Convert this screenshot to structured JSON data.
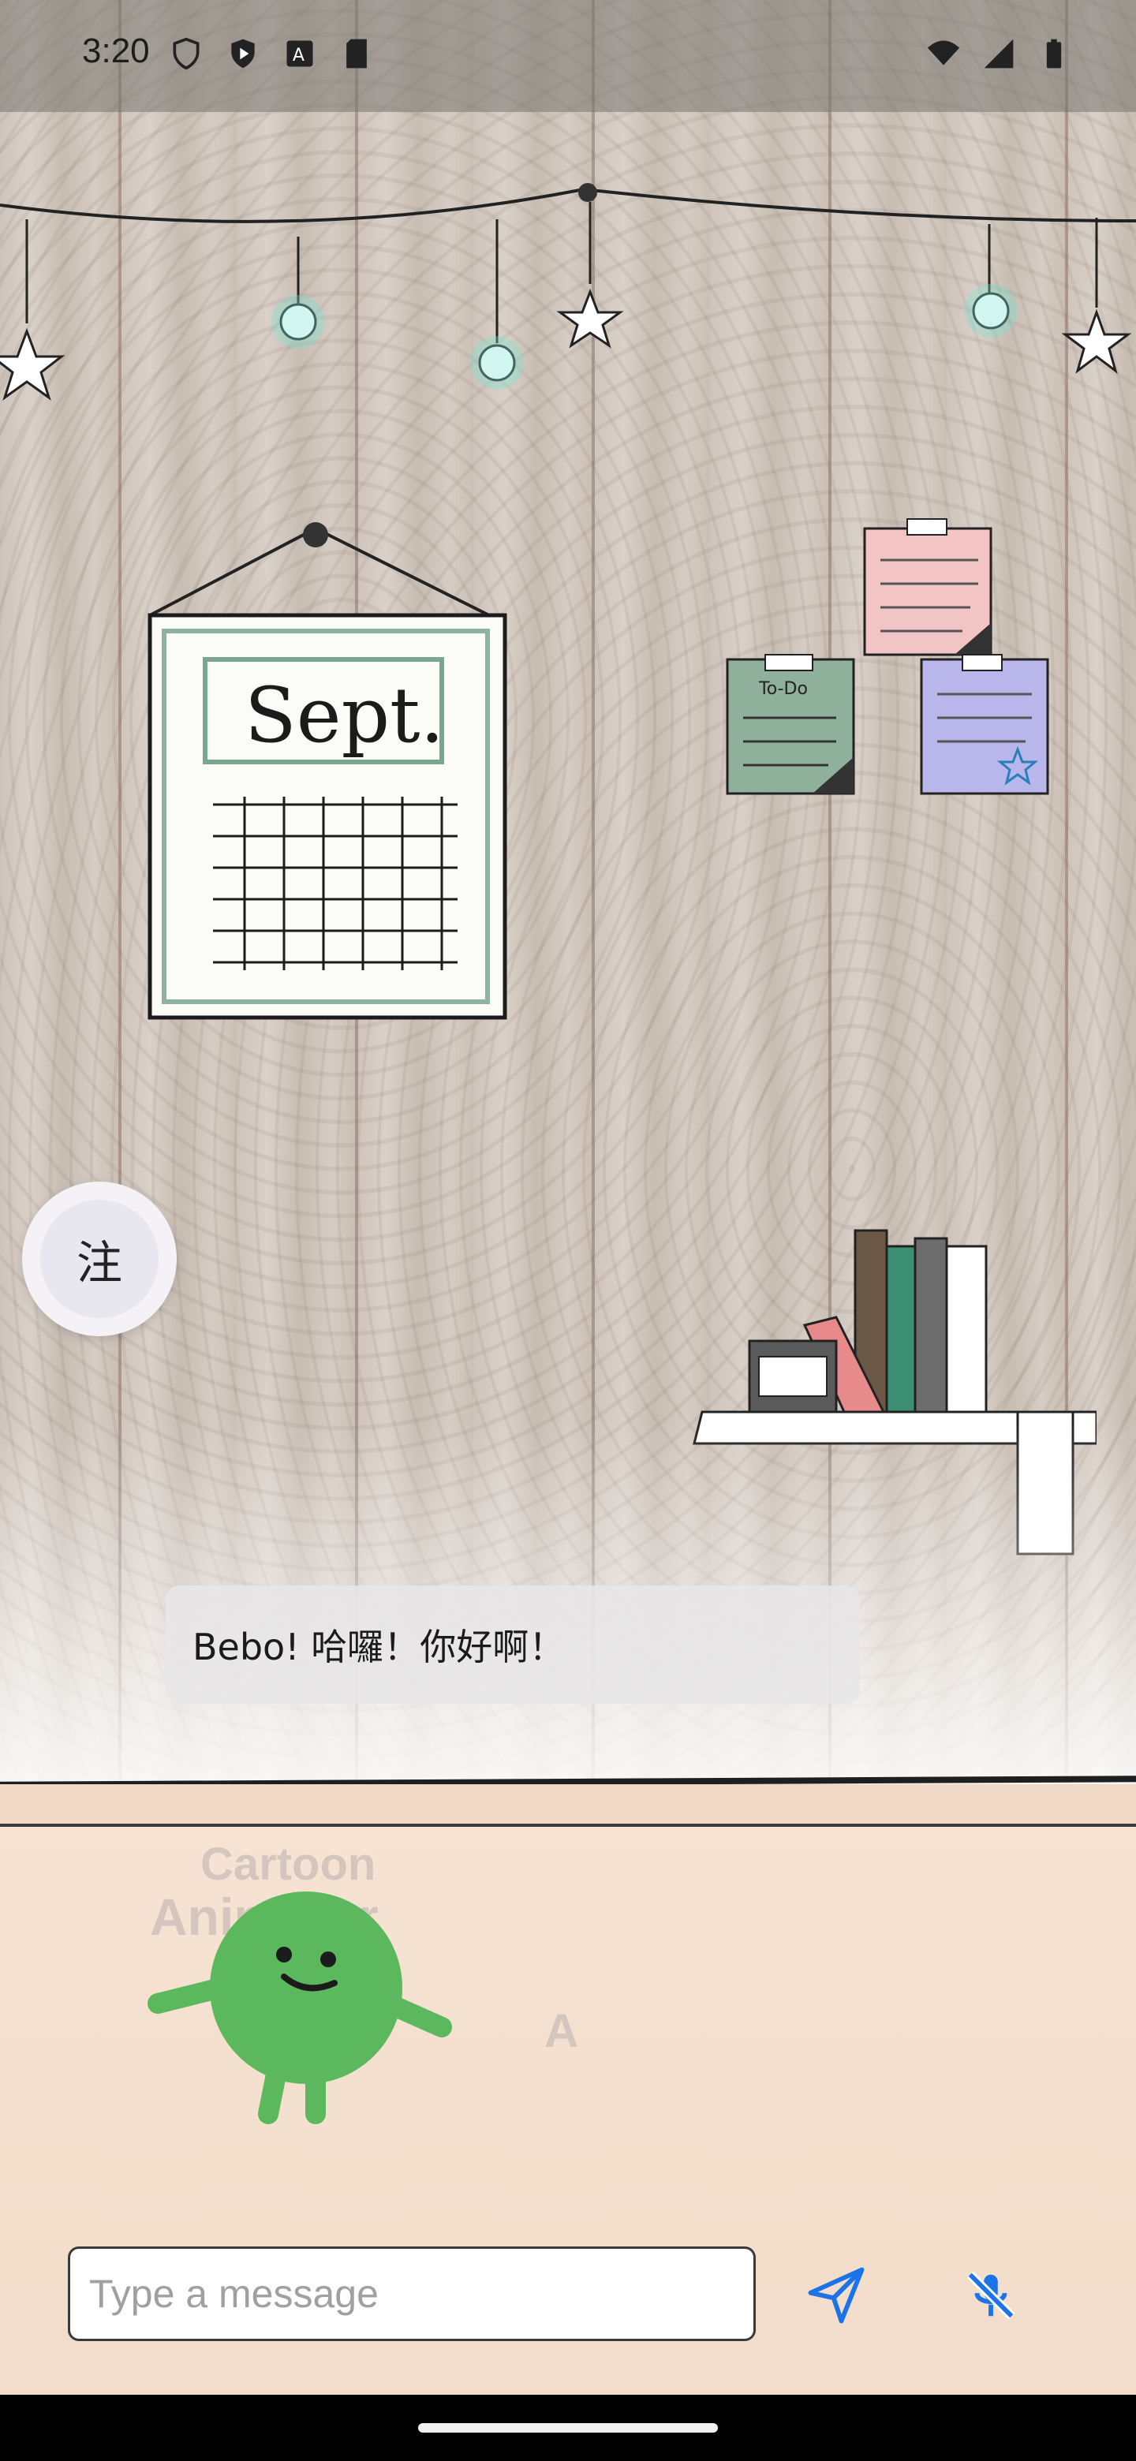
{
  "status_bar": {
    "time": "3:20",
    "left_icons": [
      "shield-outline-icon",
      "shield-play-icon",
      "font-a-icon",
      "sd-card-icon"
    ],
    "right_icons": [
      "wifi-icon",
      "cell-signal-icon",
      "battery-icon"
    ]
  },
  "scene": {
    "calendar_label": "Sept.",
    "sticky_note_label": "To-Do",
    "watermark_lines": [
      "Cartoon",
      "Animator",
      "A"
    ]
  },
  "note_button": {
    "label": "注"
  },
  "speech_bubble": {
    "text": "Bebo! 哈囉！你好啊！"
  },
  "composer": {
    "placeholder": "Type a message",
    "send_icon": "send-icon",
    "mic_icon": "mic-off-icon"
  },
  "colors": {
    "accent": "#1a73e8",
    "character": "#5cb85c",
    "bubble": "#e8e6e8"
  }
}
